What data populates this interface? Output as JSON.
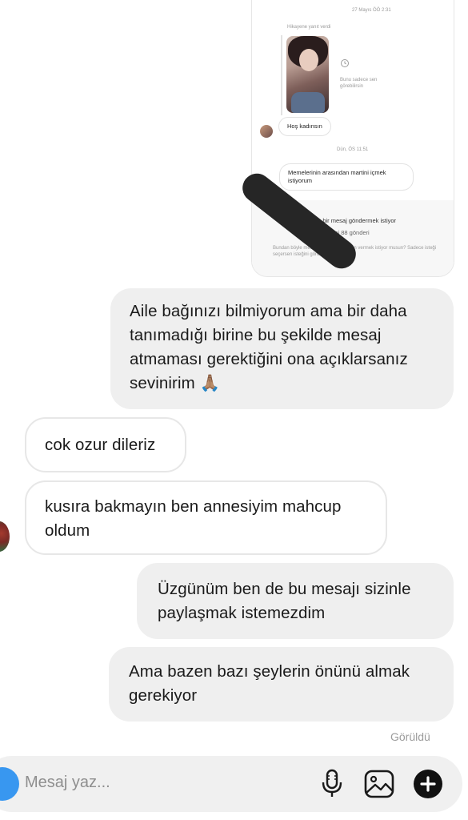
{
  "screenshot": {
    "date_top": "27 Mayıs ÖÖ 2:31",
    "story_label": "Hikayene yanıt verdi",
    "story_note": "Bunu sadece sen görebilirsin",
    "message_1": "Hoş kadınsın",
    "date_mid": "Dün, ÖS 11:51",
    "message_2": "Memelerinin arasından martini içmek istiyorum",
    "request_title": "sana bir mesaj göndermek istiyor",
    "request_sub": "akipçi 88 gönderi",
    "request_footer": "Bundan böyle mesaj göndermesine izin vermek istiyor musun? Sadece isteği seçersen isteğini gördüğünü"
  },
  "messages": [
    {
      "direction": "outgoing",
      "text": "Aile bağınızı bilmiyorum ama bir daha tanımadığı birine bu şekilde mesaj atmaması gerektiğini ona açıklarsanız sevinirim 🙏🏽"
    },
    {
      "direction": "incoming",
      "text": "cok ozur dileriz"
    },
    {
      "direction": "incoming",
      "text": "kusıra bakmayın ben annesiyim mahcup oldum"
    },
    {
      "direction": "outgoing",
      "text": "Üzgünüm ben de bu mesajı sizinle paylaşmak istemezdim"
    },
    {
      "direction": "outgoing",
      "text": "Ama bazen bazı şeylerin önünü almak gerekiyor"
    }
  ],
  "seen_label": "Görüldü",
  "composer": {
    "placeholder": "Mesaj yaz...",
    "icons": [
      "camera-icon",
      "microphone-icon",
      "gallery-icon",
      "plus-icon"
    ]
  },
  "colors": {
    "outgoing_bubble": "#efefef",
    "incoming_border": "#e7e7e7",
    "camera_button": "#3897f0",
    "seen_text": "#9b9b9b"
  }
}
